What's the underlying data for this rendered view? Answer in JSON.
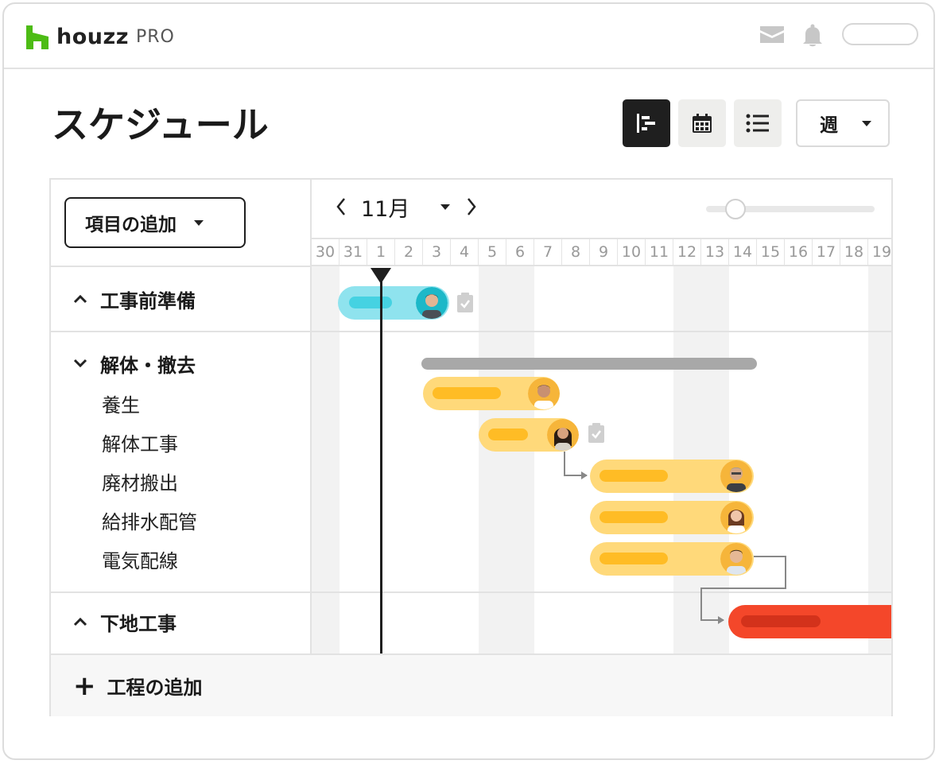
{
  "app": {
    "brand_name": "houzz",
    "brand_suffix": "PRO",
    "brand_color": "#4dbc15"
  },
  "header": {
    "page_title": "スケジュール",
    "icons": [
      "mail-icon",
      "bell-icon"
    ],
    "views": [
      {
        "name": "gantt-view",
        "active": true
      },
      {
        "name": "calendar-view",
        "active": false
      },
      {
        "name": "list-view",
        "active": false
      }
    ],
    "period_select": "週"
  },
  "sidebar": {
    "add_item_label": "項目の追加",
    "groups": [
      {
        "label": "工事前準備",
        "expanded": false,
        "items": []
      },
      {
        "label": "解体・撤去",
        "expanded": true,
        "items": [
          "養生",
          "解体工事",
          "廃材搬出",
          "給排水配管",
          "電気配線"
        ]
      },
      {
        "label": "下地工事",
        "expanded": false,
        "items": []
      }
    ],
    "add_phase_label": "工程の追加"
  },
  "timeline": {
    "month": "11月",
    "dates": [
      "30",
      "31",
      "1",
      "2",
      "3",
      "4",
      "5",
      "6",
      "7",
      "8",
      "9",
      "10",
      "11",
      "12",
      "13",
      "14",
      "15",
      "16",
      "17",
      "18",
      "19"
    ],
    "today": "1",
    "weekend_shaded": [
      "31",
      "5",
      "6",
      "12",
      "13",
      "19"
    ],
    "colors": {
      "prep": "#8fe3ee",
      "demolition": "#ffd97a",
      "groundwork": "#f4472a",
      "summary": "#a8a8a8"
    },
    "tasks": [
      {
        "name": "工事前準備",
        "start": "31",
        "end": "3",
        "color": "prep",
        "avatar": "avatar-man-1",
        "checklist": true
      },
      {
        "name": "解体・撤去",
        "start": "3",
        "end": "14",
        "color": "summary",
        "summary": true
      },
      {
        "name": "養生",
        "start": "3",
        "end": "7",
        "color": "demolition",
        "avatar": "avatar-man-2"
      },
      {
        "name": "解体工事",
        "start": "5",
        "end": "9",
        "color": "demolition",
        "avatar": "avatar-woman-1",
        "checklist": true
      },
      {
        "name": "廃材搬出",
        "start": "9",
        "end": "14",
        "color": "demolition",
        "avatar": "avatar-man-3"
      },
      {
        "name": "給排水配管",
        "start": "9",
        "end": "14",
        "color": "demolition",
        "avatar": "avatar-woman-2"
      },
      {
        "name": "電気配線",
        "start": "9",
        "end": "14",
        "color": "demolition",
        "avatar": "avatar-man-4"
      },
      {
        "name": "下地工事",
        "start": "14",
        "end": "19",
        "color": "groundwork"
      }
    ]
  }
}
